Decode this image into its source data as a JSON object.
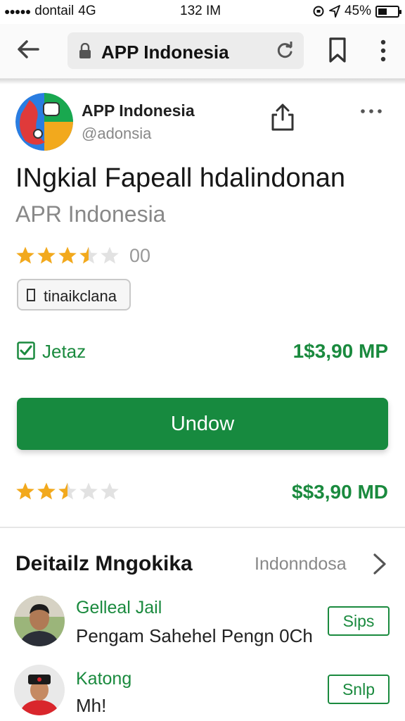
{
  "status_bar": {
    "carrier": "dontail",
    "network": "4G",
    "time": "132 IM",
    "battery": "45%",
    "battery_level": 0.45
  },
  "browser": {
    "url_text": "APP Indonesia",
    "icons": [
      "back-arrow-icon",
      "lock-icon",
      "reload-icon",
      "bookmark-icon",
      "more-vertical-icon"
    ]
  },
  "app": {
    "name": "APP Indonesia",
    "handle": "@adonsia",
    "title": "INgkial Fapeall hdalindonan",
    "subtitle": "APR Indonesia",
    "rating_value": 3.5,
    "rating_suffix": "00",
    "chip_label": "tinaikclana",
    "check_label": "Jetaz",
    "price_primary": "1$3,90 MP",
    "main_button": "Undow",
    "rating_value_2": 2.5,
    "price_secondary": "$$3,90 MD"
  },
  "colors": {
    "accent_green": "#178a3f",
    "star_gold": "#f2a91d",
    "star_empty": "#e2e2e2"
  },
  "details": {
    "title": "Deitailz Mngokika",
    "link": "Indonndosa",
    "reviews": [
      {
        "name": "Gelleal Jail",
        "text": "Pengam Sahehel  Pengn 0Ch",
        "button": "Sips"
      },
      {
        "name": "Katong",
        "text": "Mh!",
        "button": "Snlp"
      }
    ]
  }
}
